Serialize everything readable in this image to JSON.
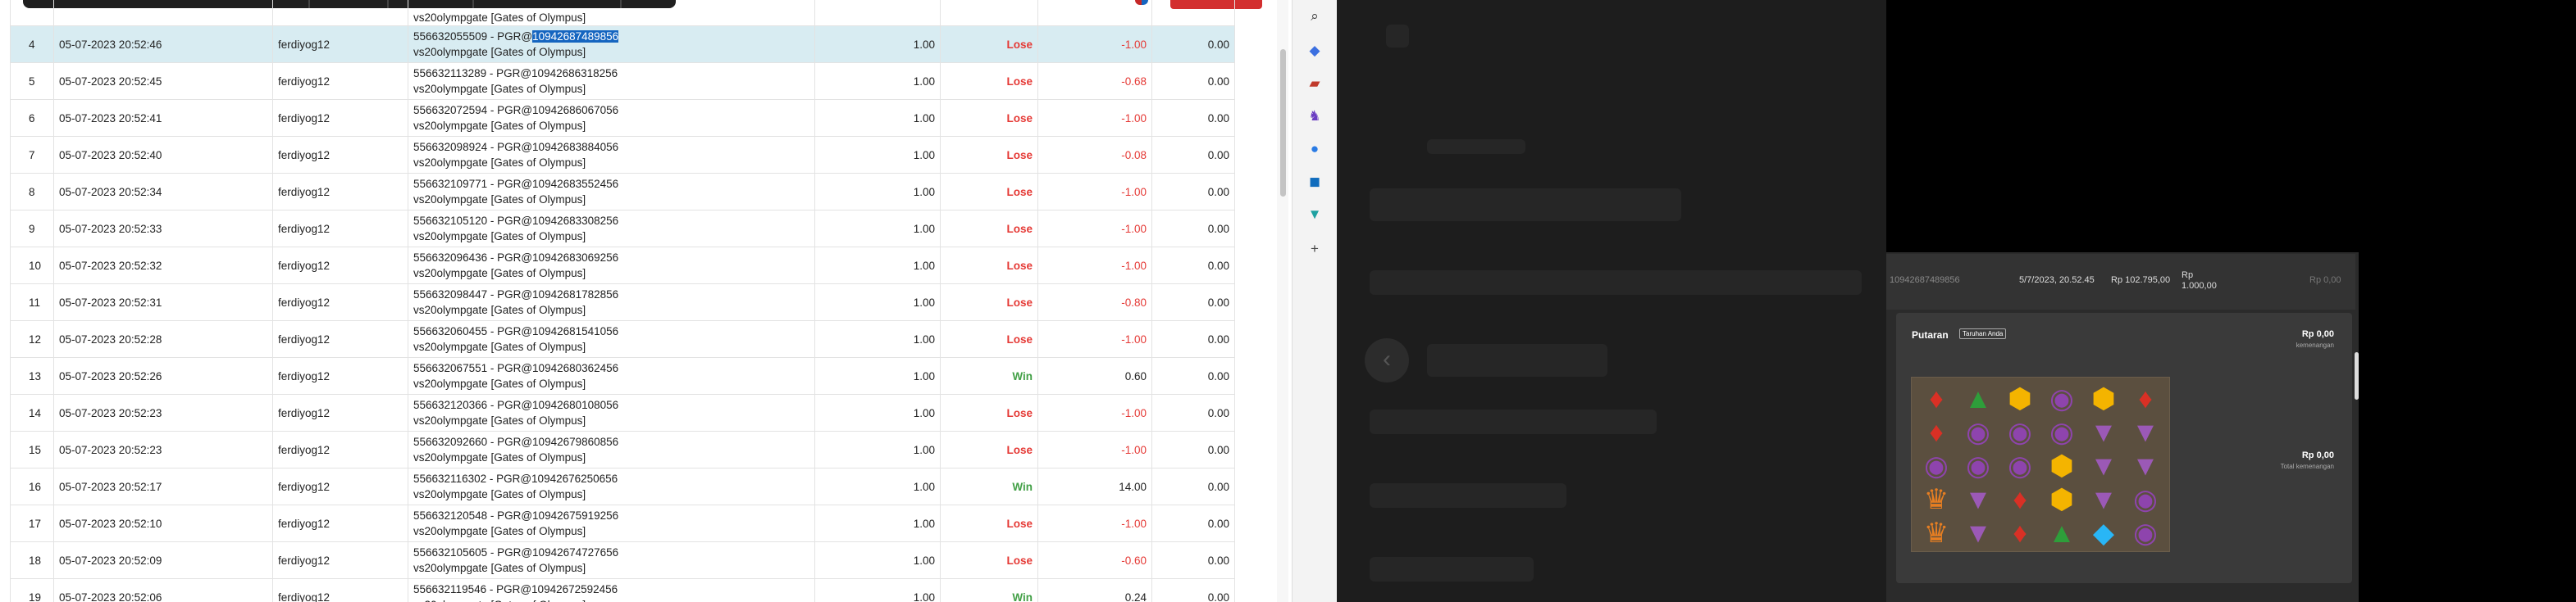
{
  "table": {
    "rows": [
      {
        "no": "4",
        "date": "05-07-2023 20:52:46",
        "user": "ferdiyog12",
        "desc_prefix": "556632055509 - PGR@",
        "desc_hl": "10942687489856",
        "desc_rest": "",
        "game": "vs20olympgate [Gates of Olympus]",
        "amount": "1.00",
        "result": "Lose",
        "value": "-1.00",
        "zero": "0.00",
        "selected": true
      },
      {
        "no": "5",
        "date": "05-07-2023 20:52:45",
        "user": "ferdiyog12",
        "desc_prefix": "556632113289 - PGR@10942686318256",
        "desc_hl": "",
        "desc_rest": "",
        "game": "vs20olympgate [Gates of Olympus]",
        "amount": "1.00",
        "result": "Lose",
        "value": "-0.68",
        "zero": "0.00"
      },
      {
        "no": "6",
        "date": "05-07-2023 20:52:41",
        "user": "ferdiyog12",
        "desc_prefix": "556632072594 - PGR@10942686067056",
        "desc_hl": "",
        "desc_rest": "",
        "game": "vs20olympgate [Gates of Olympus]",
        "amount": "1.00",
        "result": "Lose",
        "value": "-1.00",
        "zero": "0.00"
      },
      {
        "no": "7",
        "date": "05-07-2023 20:52:40",
        "user": "ferdiyog12",
        "desc_prefix": "556632098924 - PGR@10942683884056",
        "desc_hl": "",
        "desc_rest": "",
        "game": "vs20olympgate [Gates of Olympus]",
        "amount": "1.00",
        "result": "Lose",
        "value": "-0.08",
        "zero": "0.00"
      },
      {
        "no": "8",
        "date": "05-07-2023 20:52:34",
        "user": "ferdiyog12",
        "desc_prefix": "556632109771 - PGR@10942683552456",
        "desc_hl": "",
        "desc_rest": "",
        "game": "vs20olympgate [Gates of Olympus]",
        "amount": "1.00",
        "result": "Lose",
        "value": "-1.00",
        "zero": "0.00"
      },
      {
        "no": "9",
        "date": "05-07-2023 20:52:33",
        "user": "ferdiyog12",
        "desc_prefix": "556632105120 - PGR@10942683308256",
        "desc_hl": "",
        "desc_rest": "",
        "game": "vs20olympgate [Gates of Olympus]",
        "amount": "1.00",
        "result": "Lose",
        "value": "-1.00",
        "zero": "0.00"
      },
      {
        "no": "10",
        "date": "05-07-2023 20:52:32",
        "user": "ferdiyog12",
        "desc_prefix": "556632096436 - PGR@10942683069256",
        "desc_hl": "",
        "desc_rest": "",
        "game": "vs20olympgate [Gates of Olympus]",
        "amount": "1.00",
        "result": "Lose",
        "value": "-1.00",
        "zero": "0.00"
      },
      {
        "no": "11",
        "date": "05-07-2023 20:52:31",
        "user": "ferdiyog12",
        "desc_prefix": "556632098447 - PGR@10942681782856",
        "desc_hl": "",
        "desc_rest": "",
        "game": "vs20olympgate [Gates of Olympus]",
        "amount": "1.00",
        "result": "Lose",
        "value": "-0.80",
        "zero": "0.00"
      },
      {
        "no": "12",
        "date": "05-07-2023 20:52:28",
        "user": "ferdiyog12",
        "desc_prefix": "556632060455 - PGR@10942681541056",
        "desc_hl": "",
        "desc_rest": "",
        "game": "vs20olympgate [Gates of Olympus]",
        "amount": "1.00",
        "result": "Lose",
        "value": "-1.00",
        "zero": "0.00"
      },
      {
        "no": "13",
        "date": "05-07-2023 20:52:26",
        "user": "ferdiyog12",
        "desc_prefix": "556632067551 - PGR@10942680362456",
        "desc_hl": "",
        "desc_rest": "",
        "game": "vs20olympgate [Gates of Olympus]",
        "amount": "1.00",
        "result": "Win",
        "value": "0.60",
        "zero": "0.00"
      },
      {
        "no": "14",
        "date": "05-07-2023 20:52:23",
        "user": "ferdiyog12",
        "desc_prefix": "556632120366 - PGR@10942680108056",
        "desc_hl": "",
        "desc_rest": "",
        "game": "vs20olympgate [Gates of Olympus]",
        "amount": "1.00",
        "result": "Lose",
        "value": "-1.00",
        "zero": "0.00"
      },
      {
        "no": "15",
        "date": "05-07-2023 20:52:23",
        "user": "ferdiyog12",
        "desc_prefix": "556632092660 - PGR@10942679860856",
        "desc_hl": "",
        "desc_rest": "",
        "game": "vs20olympgate [Gates of Olympus]",
        "amount": "1.00",
        "result": "Lose",
        "value": "-1.00",
        "zero": "0.00"
      },
      {
        "no": "16",
        "date": "05-07-2023 20:52:17",
        "user": "ferdiyog12",
        "desc_prefix": "556632116302 - PGR@10942676250656",
        "desc_hl": "",
        "desc_rest": "",
        "game": "vs20olympgate [Gates of Olympus]",
        "amount": "1.00",
        "result": "Win",
        "value": "14.00",
        "zero": "0.00"
      },
      {
        "no": "17",
        "date": "05-07-2023 20:52:10",
        "user": "ferdiyog12",
        "desc_prefix": "556632120548 - PGR@10942675919256",
        "desc_hl": "",
        "desc_rest": "",
        "game": "vs20olympgate [Gates of Olympus]",
        "amount": "1.00",
        "result": "Lose",
        "value": "-1.00",
        "zero": "0.00"
      },
      {
        "no": "18",
        "date": "05-07-2023 20:52:09",
        "user": "ferdiyog12",
        "desc_prefix": "556632105605 - PGR@10942674727656",
        "desc_hl": "",
        "desc_rest": "",
        "game": "vs20olympgate [Gates of Olympus]",
        "amount": "1.00",
        "result": "Lose",
        "value": "-0.60",
        "zero": "0.00"
      },
      {
        "no": "19",
        "date": "05-07-2023 20:52:06",
        "user": "ferdiyog12",
        "desc_prefix": "556632119546 - PGR@10942672592456",
        "desc_hl": "",
        "desc_rest": "",
        "game": "vs20olympgate [Gates of Olympus]",
        "amount": "1.00",
        "result": "Win",
        "value": "0.24",
        "zero": "0.00"
      }
    ],
    "top_partial_game": "vs20olympgate [Gates of Olympus]"
  },
  "colors": {
    "lose": "#e53935",
    "win": "#43a047",
    "selected_row": "#d8ecf2",
    "highlight": "#1565c0"
  },
  "sidebar_icons": [
    "search-icon",
    "tag-icon",
    "briefcase-icon",
    "chess-icon",
    "copilot-icon",
    "outlook-icon",
    "drive-icon",
    "plus-icon"
  ],
  "game_panel": {
    "info": {
      "round_id": "10942687489856",
      "datetime": "5/7/2023, 20.52.45",
      "balance": "Rp 102.795,00",
      "bet_line1": "Rp",
      "bet_line2": "1.000,00",
      "win": "Rp 0,00"
    },
    "round_title": "Putaran",
    "badge": "Taruhan Anda",
    "win_amount": "Rp 0,00",
    "win_label": "kemenangan",
    "total_amount": "Rp 0,00",
    "total_label": "Total kemenangan"
  }
}
